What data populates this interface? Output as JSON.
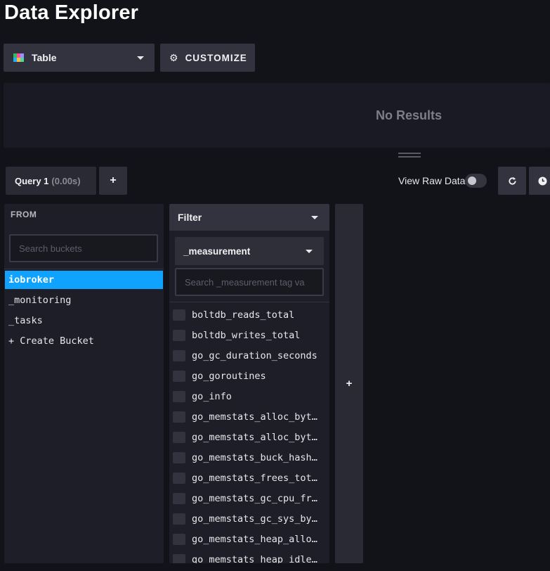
{
  "page": {
    "title": "Data Explorer"
  },
  "toolbar": {
    "visualization_type": "Table",
    "customize_label": "CUSTOMIZE",
    "icons": {
      "table": "table-icon",
      "customize": "gear-icon"
    }
  },
  "results": {
    "empty_text": "No Results"
  },
  "query_bar": {
    "tab_name": "Query 1",
    "tab_time": "(0.00s)",
    "add_label": "+",
    "raw_data_label": "View Raw Data",
    "raw_data_on": false,
    "icons": {
      "refresh": "refresh-icon",
      "time": "clock-icon"
    }
  },
  "from": {
    "header": "FROM",
    "search_placeholder": "Search buckets",
    "buckets": [
      "iobroker",
      "_monitoring",
      "_tasks"
    ],
    "selected_bucket": "iobroker",
    "create_label": "+ Create Bucket"
  },
  "filter": {
    "header": "Filter",
    "key": "_measurement",
    "search_placeholder": "Search _measurement tag va",
    "values": [
      "boltdb_reads_total",
      "boltdb_writes_total",
      "go_gc_duration_seconds",
      "go_goroutines",
      "go_info",
      "go_memstats_alloc_bytes",
      "go_memstats_alloc_bytes_total",
      "go_memstats_buck_hash_sys_bytes",
      "go_memstats_frees_total",
      "go_memstats_gc_cpu_fraction",
      "go_memstats_gc_sys_bytes",
      "go_memstats_heap_alloc_bytes",
      "go_memstats_heap_idle_bytes"
    ]
  },
  "add_function": {
    "label": "+"
  },
  "colors": {
    "accent": "#0fa3ff",
    "background": "#121219",
    "panel": "#1e1e28",
    "button": "#33333f"
  }
}
